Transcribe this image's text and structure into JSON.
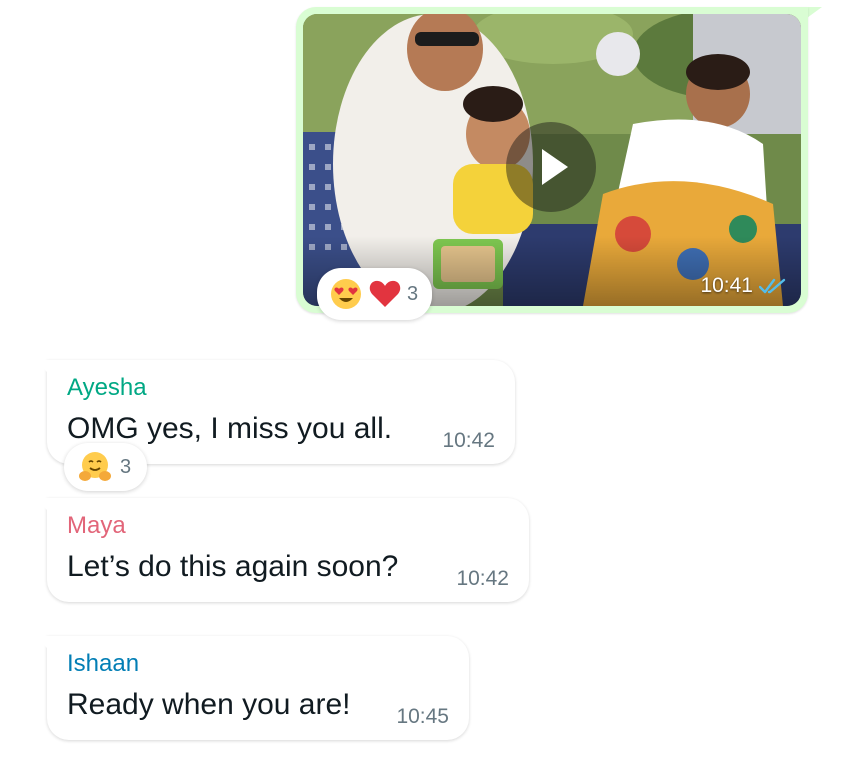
{
  "outgoing_message": {
    "type": "video",
    "time": "10:41",
    "status_icon": "double-check-read-icon",
    "reactions": {
      "emojis": [
        "😍",
        "❤️"
      ],
      "count": "3"
    }
  },
  "incoming_messages": [
    {
      "sender": "Ayesha",
      "sender_color": "#00a884",
      "text": "OMG yes, I miss you all.",
      "time": "10:42",
      "reactions": {
        "emojis": [
          "🤗"
        ],
        "count": "3"
      }
    },
    {
      "sender": "Maya",
      "sender_color": "#e26579",
      "text": "Let’s do this again soon?",
      "time": "10:42"
    },
    {
      "sender": "Ishaan",
      "sender_color": "#027eb5",
      "text": "Ready when you are!",
      "time": "10:45"
    }
  ],
  "colors": {
    "outgoing_bubble": "#d9fdd3",
    "incoming_bubble": "#ffffff",
    "read_ticks": "#53bdeb",
    "timestamp": "#667781"
  }
}
